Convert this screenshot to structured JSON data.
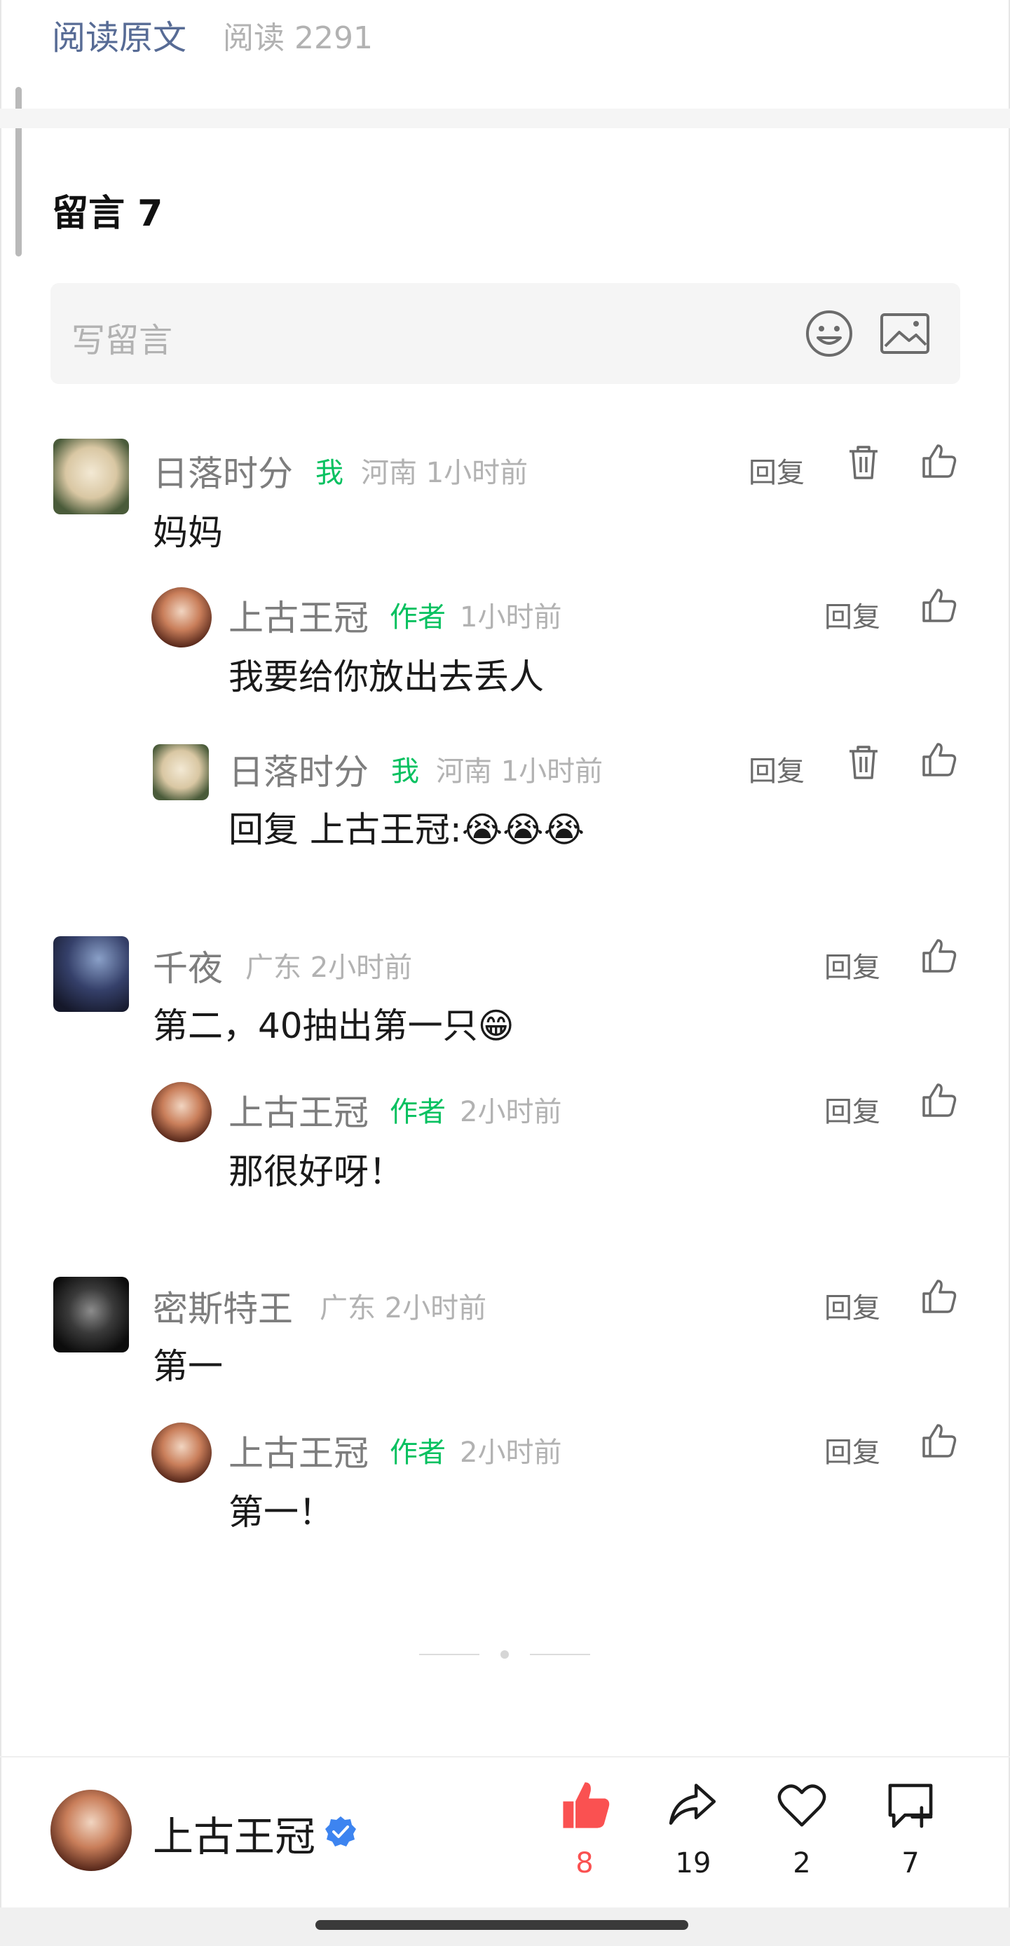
{
  "article": {
    "read_original": "阅读原文",
    "read_count": "阅读 2291"
  },
  "comments_header": {
    "title": "留言 7"
  },
  "write_comment": {
    "placeholder": "写留言",
    "emoji_icon": "smiley-icon",
    "image_icon": "image-icon"
  },
  "comments": [
    {
      "user": "日落时分",
      "tag": "我",
      "meta": "河南 1小时前",
      "text": "妈妈",
      "reply": "回复",
      "replies": [
        {
          "user": "上古王冠",
          "tag": "作者",
          "meta": "1小时前",
          "text": "我要给你放出去丢人",
          "reply": "回复"
        },
        {
          "user": "日落时分",
          "tag": "我",
          "meta": "河南 1小时前",
          "text": "回复 上古王冠:😭😭😭",
          "reply": "回复"
        }
      ]
    },
    {
      "user": "千夜",
      "meta": "广东 2小时前",
      "text": "第二，40抽出第一只😁",
      "reply": "回复",
      "replies": [
        {
          "user": "上古王冠",
          "tag": "作者",
          "meta": "2小时前",
          "text": "那很好呀！",
          "reply": "回复"
        }
      ]
    },
    {
      "user": "密斯特王",
      "meta": "广东 2小时前",
      "text": "第一",
      "reply": "回复",
      "replies": [
        {
          "user": "上古王冠",
          "tag": "作者",
          "meta": "2小时前",
          "text": "第一！",
          "reply": "回复"
        }
      ]
    }
  ],
  "bottom_bar": {
    "author_name": "上古王冠",
    "actions": [
      {
        "icon": "thumbs-up-filled-icon",
        "count": "8",
        "color": "#fa5151"
      },
      {
        "icon": "share-arrow-icon",
        "count": "19",
        "color": "#1a1a1a"
      },
      {
        "icon": "heart-icon",
        "count": "2",
        "color": "#1a1a1a"
      },
      {
        "icon": "comment-plus-icon",
        "count": "7",
        "color": "#1a1a1a"
      }
    ]
  },
  "colors": {
    "link": "#576b95",
    "tag_green": "#07c160",
    "like_red": "#fa5151",
    "verified_blue": "#3d84f0"
  }
}
